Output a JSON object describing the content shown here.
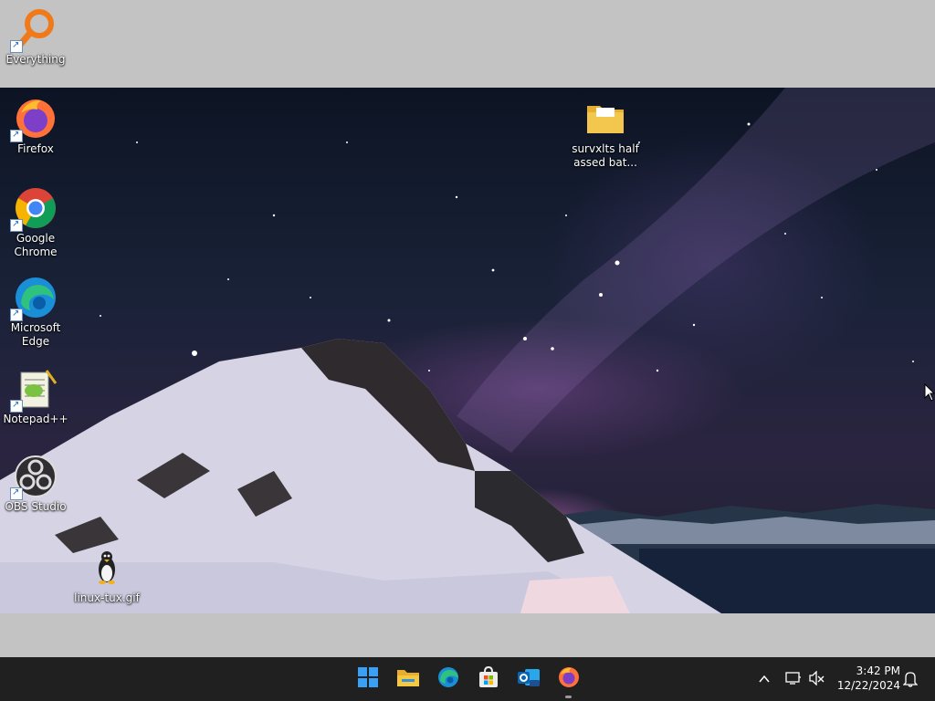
{
  "desktop": {
    "icons": [
      {
        "label": "Everything",
        "icon": "magnifier-icon"
      },
      {
        "label": "Firefox",
        "icon": "firefox-icon"
      },
      {
        "label": "Google Chrome",
        "icon": "chrome-icon"
      },
      {
        "label": "Microsoft Edge",
        "icon": "edge-icon"
      },
      {
        "label": "Notepad++",
        "icon": "notepad-plus-plus-icon"
      },
      {
        "label": "OBS Studio",
        "icon": "obs-studio-icon"
      },
      {
        "label": "linux-tux.gif",
        "icon": "tux-penguin-icon"
      },
      {
        "label": "survxlts half assed bat...",
        "icon": "folder-icon"
      }
    ]
  },
  "taskbar": {
    "pinned": [
      "start-icon",
      "file-explorer-icon",
      "edge-icon",
      "microsoft-store-icon",
      "outlook-icon",
      "firefox-icon"
    ],
    "clock": {
      "time": "3:42 PM",
      "date": "12/22/2024"
    },
    "tray": [
      "chevron-up-icon",
      "network-icon",
      "volume-muted-icon",
      "notification-bell-icon"
    ]
  },
  "colors": {
    "taskbar": "#202020",
    "folder": "#f3c64e",
    "accent": "#0078d4"
  }
}
